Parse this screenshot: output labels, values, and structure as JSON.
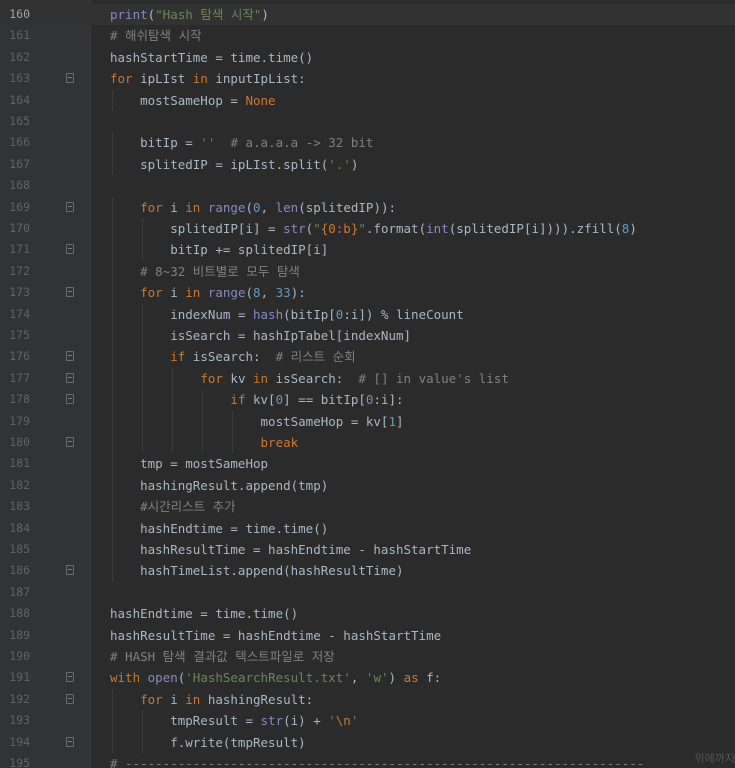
{
  "editor": {
    "current_line": 160,
    "lines": [
      {
        "n": 160,
        "code": "print(\"Hash 탐색 시작\")"
      },
      {
        "n": 161,
        "code": "# 해쉬탐색 시작"
      },
      {
        "n": 162,
        "code": "hashStartTime = time.time()"
      },
      {
        "n": 163,
        "code": "for ipLIst in inputIpList:"
      },
      {
        "n": 164,
        "code": "    mostSameHop = None"
      },
      {
        "n": 165,
        "code": ""
      },
      {
        "n": 166,
        "code": "    bitIp = ''  # a.a.a.a -> 32 bit"
      },
      {
        "n": 167,
        "code": "    splitedIP = ipLIst.split('.')"
      },
      {
        "n": 168,
        "code": ""
      },
      {
        "n": 169,
        "code": "    for i in range(0, len(splitedIP)):"
      },
      {
        "n": 170,
        "code": "        splitedIP[i] = str(\"{0:b}\".format(int(splitedIP[i]))).zfill(8)"
      },
      {
        "n": 171,
        "code": "        bitIp += splitedIP[i]"
      },
      {
        "n": 172,
        "code": "    # 8~32 비트별로 모두 탐색"
      },
      {
        "n": 173,
        "code": "    for i in range(8, 33):"
      },
      {
        "n": 174,
        "code": "        indexNum = hash(bitIp[0:i]) % lineCount"
      },
      {
        "n": 175,
        "code": "        isSearch = hashIpTabel[indexNum]"
      },
      {
        "n": 176,
        "code": "        if isSearch:  # 리스트 순회"
      },
      {
        "n": 177,
        "code": "            for kv in isSearch:  # [] in value's list"
      },
      {
        "n": 178,
        "code": "                if kv[0] == bitIp[0:i]:"
      },
      {
        "n": 179,
        "code": "                    mostSameHop = kv[1]"
      },
      {
        "n": 180,
        "code": "                    break"
      },
      {
        "n": 181,
        "code": "    tmp = mostSameHop"
      },
      {
        "n": 182,
        "code": "    hashingResult.append(tmp)"
      },
      {
        "n": 183,
        "code": "    #시간리스트 추가"
      },
      {
        "n": 184,
        "code": "    hashEndtime = time.time()"
      },
      {
        "n": 185,
        "code": "    hashResultTime = hashEndtime - hashStartTime"
      },
      {
        "n": 186,
        "code": "    hashTimeList.append(hashResultTime)"
      },
      {
        "n": 187,
        "code": ""
      },
      {
        "n": 188,
        "code": "hashEndtime = time.time()"
      },
      {
        "n": 189,
        "code": "hashResultTime = hashEndtime - hashStartTime"
      },
      {
        "n": 190,
        "code": "# HASH 탐색 결과값 텍스트파일로 저장"
      },
      {
        "n": 191,
        "code": "with open('HashSearchResult.txt', 'w') as f:"
      },
      {
        "n": 192,
        "code": "    for i in hashingResult:"
      },
      {
        "n": 193,
        "code": "        tmpResult = str(i) + '\\n'"
      },
      {
        "n": 194,
        "code": "        f.write(tmpResult)"
      },
      {
        "n": 195,
        "code": "# ---------------------------------------------------------------------"
      }
    ],
    "fold_lines": [
      163,
      169,
      171,
      173,
      176,
      177,
      178,
      180,
      186,
      191,
      192,
      194
    ],
    "watermark": "위에까지"
  }
}
